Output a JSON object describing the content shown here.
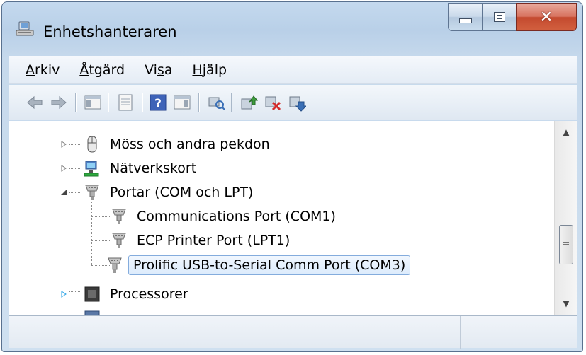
{
  "window": {
    "title": "Enhetshanteraren",
    "caption_buttons": {
      "minimize": "minimize",
      "maximize": "maximize",
      "close": "close"
    }
  },
  "menu": [
    {
      "label": "Arkiv",
      "accel": "A"
    },
    {
      "label": "Åtgärd",
      "accel": "Å"
    },
    {
      "label": "Visa",
      "accel": "s"
    },
    {
      "label": "Hjälp",
      "accel": "H"
    }
  ],
  "toolbar": {
    "buttons": [
      "back-arrow-icon",
      "forward-arrow-icon",
      "show-hide-console-tree-icon",
      "properties-icon",
      "help-icon",
      "show-action-pane-icon",
      "scan-hardware-changes-icon",
      "update-driver-icon",
      "disable-device-icon",
      "uninstall-device-icon"
    ]
  },
  "tree": {
    "nodes": [
      {
        "label": "Möss och andra pekdon",
        "level": 0,
        "expanded": false,
        "icon": "mouse-icon"
      },
      {
        "label": "Nätverkskort",
        "level": 0,
        "expanded": false,
        "icon": "network-adapter-icon"
      },
      {
        "label": "Portar (COM och LPT)",
        "level": 0,
        "expanded": true,
        "icon": "port-connector-icon"
      },
      {
        "label": "Communications Port (COM1)",
        "level": 1,
        "icon": "port-connector-icon"
      },
      {
        "label": "ECP Printer Port (LPT1)",
        "level": 1,
        "icon": "port-connector-icon"
      },
      {
        "label": "Prolific USB-to-Serial Comm Port (COM3)",
        "level": 1,
        "icon": "port-connector-icon",
        "selected": true
      },
      {
        "label": "Processorer",
        "level": 0,
        "expanded": false,
        "icon": "processor-icon"
      }
    ]
  },
  "statusbar": {
    "panes": [
      "",
      "",
      ""
    ]
  }
}
